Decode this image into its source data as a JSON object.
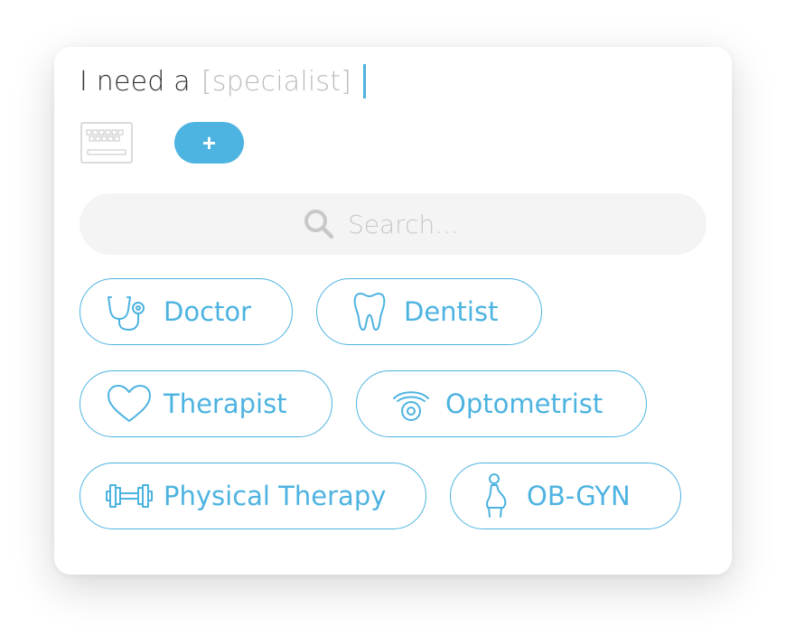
{
  "prompt": {
    "prefix": "I need a",
    "placeholder": "[specialist]"
  },
  "toolbar": {
    "keyboard_icon": "keyboard-icon",
    "add_label": "+"
  },
  "search": {
    "placeholder": "Search...",
    "value": ""
  },
  "specialists": [
    {
      "label": "Doctor",
      "icon": "stethoscope-icon"
    },
    {
      "label": "Dentist",
      "icon": "tooth-icon"
    },
    {
      "label": "Therapist",
      "icon": "heart-icon"
    },
    {
      "label": "Optometrist",
      "icon": "eye-icon"
    },
    {
      "label": "Physical Therapy",
      "icon": "dumbbell-icon"
    },
    {
      "label": "OB-GYN",
      "icon": "pregnant-woman-icon"
    }
  ],
  "colors": {
    "accent": "#4db3e0",
    "search_background": "#f4f4f4",
    "placeholder_text": "#bdbdbd"
  }
}
